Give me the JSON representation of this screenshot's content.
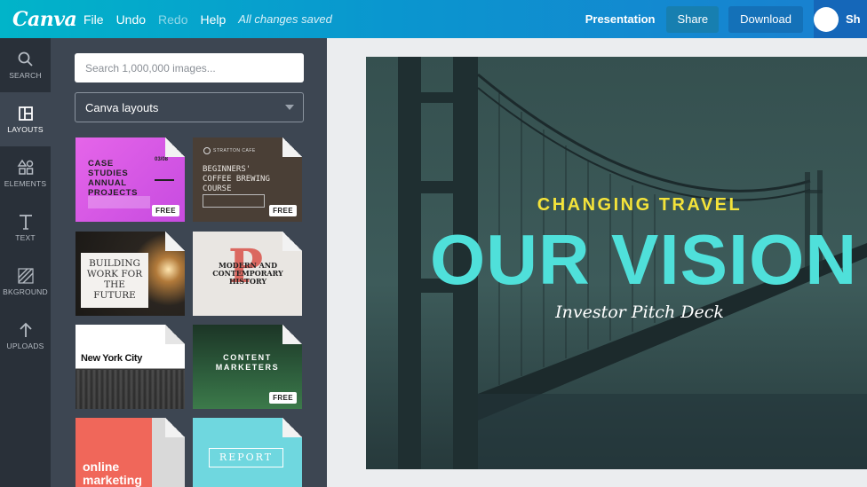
{
  "app": {
    "logo": "Canva"
  },
  "menu": {
    "file": "File",
    "undo": "Undo",
    "redo": "Redo",
    "help": "Help",
    "status": "All changes saved"
  },
  "top_right": {
    "doc_type": "Presentation",
    "share": "Share",
    "download": "Download",
    "user_initials": "Sh"
  },
  "rail": {
    "items": [
      {
        "label": "SEARCH",
        "icon": "search-icon"
      },
      {
        "label": "LAYOUTS",
        "icon": "layouts-icon"
      },
      {
        "label": "ELEMENTS",
        "icon": "elements-icon"
      },
      {
        "label": "TEXT",
        "icon": "text-icon"
      },
      {
        "label": "BKGROUND",
        "icon": "background-icon"
      },
      {
        "label": "UPLOADS",
        "icon": "upload-icon"
      }
    ]
  },
  "panel": {
    "search_placeholder": "Search 1,000,000 images...",
    "dropdown_value": "Canva layouts",
    "templates": [
      {
        "title": "CASE STUDIES ANNUAL PROJECTS",
        "page": "03/08",
        "badge": "FREE"
      },
      {
        "title": "BEGINNERS' COFFEE BREWING COURSE",
        "brand": "STRATTON CAFE",
        "badge": "FREE"
      },
      {
        "title": "BUILDING WORK FOR THE FUTURE"
      },
      {
        "title": "MODERN AND CONTEMPORARY HISTORY",
        "letter": "P"
      },
      {
        "title": "New York City"
      },
      {
        "title": "CONTENT MARKETERS",
        "badge": "FREE"
      },
      {
        "title": "online marketing"
      },
      {
        "title": "REPORT"
      }
    ]
  },
  "slide": {
    "kicker": "CHANGING TRAVEL",
    "headline": "OUR VISION",
    "subtitle": "Investor Pitch Deck"
  },
  "colors": {
    "accent_teal": "#4fe0da",
    "accent_yellow": "#f4e33a",
    "panel_bg": "#3d4652",
    "rail_bg": "#293039"
  }
}
